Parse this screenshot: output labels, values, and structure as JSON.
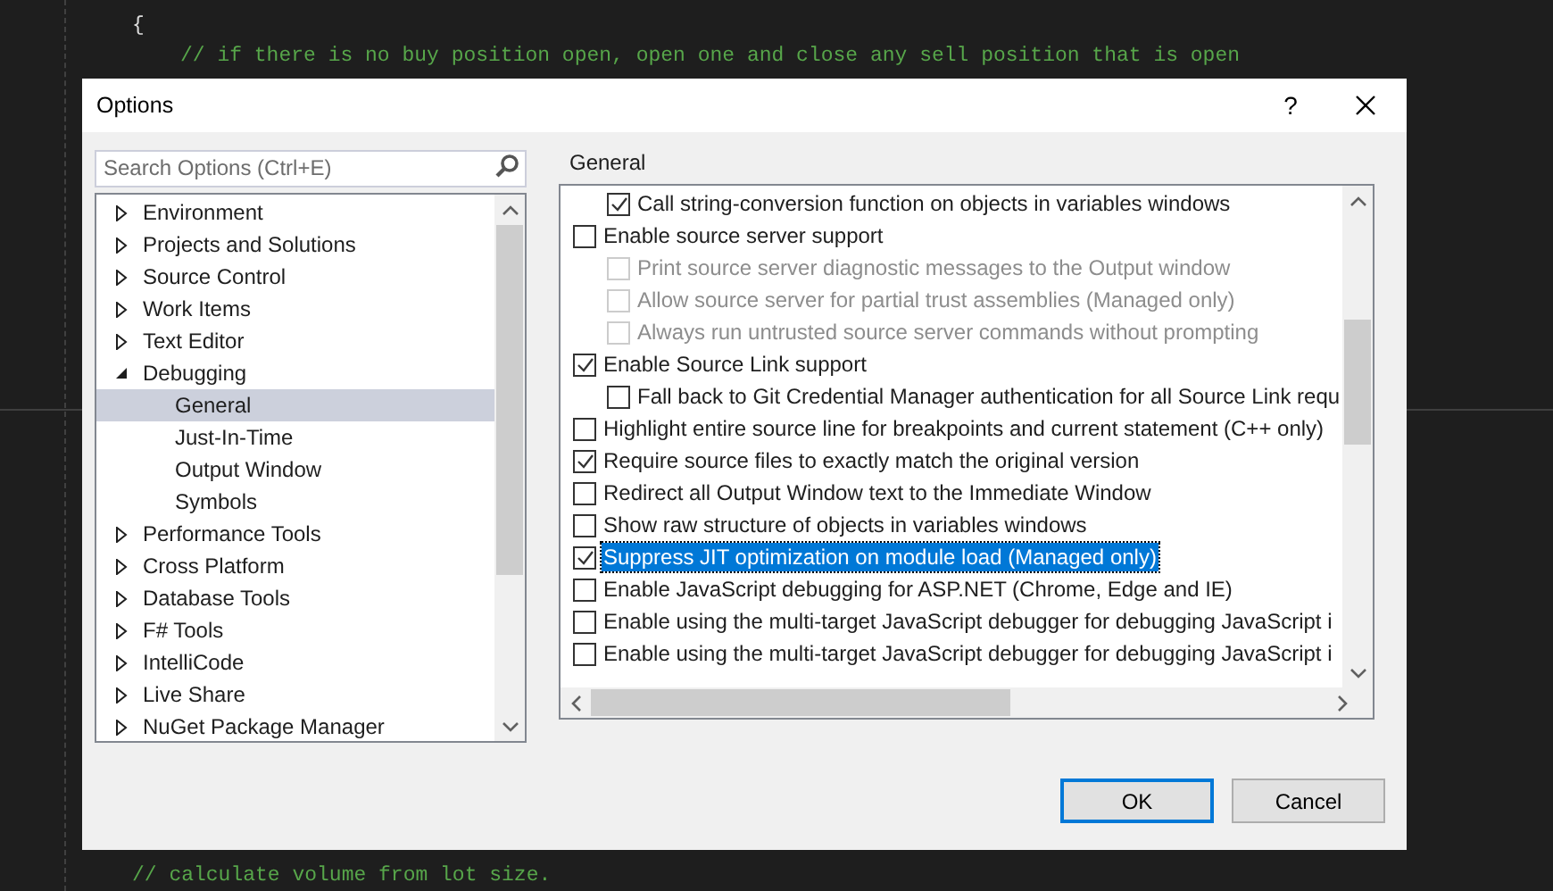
{
  "editor": {
    "lines": [
      {
        "text": "{",
        "kind": "brace"
      },
      {
        "text": "// if there is no buy position open, open one and close any sell position that is open",
        "kind": "inner_comment"
      }
    ],
    "bottom_lines": [
      {
        "text": "// calculate volume from lot size.",
        "kind": "comment"
      }
    ]
  },
  "dialog": {
    "title": "Options",
    "help": "?",
    "search": {
      "placeholder": "Search Options (Ctrl+E)"
    },
    "tree": [
      {
        "label": "Environment",
        "expanded": false,
        "selected": false
      },
      {
        "label": "Projects and Solutions",
        "expanded": false,
        "selected": false
      },
      {
        "label": "Source Control",
        "expanded": false,
        "selected": false
      },
      {
        "label": "Work Items",
        "expanded": false,
        "selected": false
      },
      {
        "label": "Text Editor",
        "expanded": false,
        "selected": false
      },
      {
        "label": "Debugging",
        "expanded": true,
        "selected": false,
        "children": [
          {
            "label": "General",
            "selected": true
          },
          {
            "label": "Just-In-Time",
            "selected": false
          },
          {
            "label": "Output Window",
            "selected": false
          },
          {
            "label": "Symbols",
            "selected": false
          }
        ]
      },
      {
        "label": "Performance Tools",
        "expanded": false,
        "selected": false
      },
      {
        "label": "Cross Platform",
        "expanded": false,
        "selected": false
      },
      {
        "label": "Database Tools",
        "expanded": false,
        "selected": false
      },
      {
        "label": "F# Tools",
        "expanded": false,
        "selected": false
      },
      {
        "label": "IntelliCode",
        "expanded": false,
        "selected": false
      },
      {
        "label": "Live Share",
        "expanded": false,
        "selected": false
      },
      {
        "label": "NuGet Package Manager",
        "expanded": false,
        "selected": false
      }
    ],
    "section": "General",
    "options": [
      {
        "kind": "sub",
        "label": "Call string-conversion function on objects in variables windows",
        "checked": true,
        "disabled": false,
        "selected": false
      },
      {
        "kind": "top",
        "label": "Enable source server support",
        "checked": false,
        "disabled": false,
        "selected": false
      },
      {
        "kind": "sub",
        "label": "Print source server diagnostic messages to the Output window",
        "checked": false,
        "disabled": true,
        "selected": false
      },
      {
        "kind": "sub",
        "label": "Allow source server for partial trust assemblies (Managed only)",
        "checked": false,
        "disabled": true,
        "selected": false
      },
      {
        "kind": "sub",
        "label": "Always run untrusted source server commands without prompting",
        "checked": false,
        "disabled": true,
        "selected": false
      },
      {
        "kind": "top",
        "label": "Enable Source Link support",
        "checked": true,
        "disabled": false,
        "selected": false
      },
      {
        "kind": "sub",
        "label": "Fall back to Git Credential Manager authentication for all Source Link requ",
        "checked": false,
        "disabled": false,
        "selected": false
      },
      {
        "kind": "top",
        "label": "Highlight entire source line for breakpoints and current statement (C++ only)",
        "checked": false,
        "disabled": false,
        "selected": false
      },
      {
        "kind": "top",
        "label": "Require source files to exactly match the original version",
        "checked": true,
        "disabled": false,
        "selected": false
      },
      {
        "kind": "top",
        "label": "Redirect all Output Window text to the Immediate Window",
        "checked": false,
        "disabled": false,
        "selected": false
      },
      {
        "kind": "top",
        "label": "Show raw structure of objects in variables windows",
        "checked": false,
        "disabled": false,
        "selected": false
      },
      {
        "kind": "top",
        "label": "Suppress JIT optimization on module load (Managed only)",
        "checked": true,
        "disabled": false,
        "selected": true
      },
      {
        "kind": "top",
        "label": "Enable JavaScript debugging for ASP.NET (Chrome, Edge and IE)",
        "checked": false,
        "disabled": false,
        "selected": false
      },
      {
        "kind": "top",
        "label": "Enable using the multi-target JavaScript debugger for debugging JavaScript i",
        "checked": false,
        "disabled": false,
        "selected": false
      },
      {
        "kind": "top",
        "label": "Enable using the multi-target JavaScript debugger for debugging JavaScript i",
        "checked": false,
        "disabled": false,
        "selected": false
      }
    ],
    "buttons": [
      {
        "label": "OK",
        "kind": "default"
      },
      {
        "label": "Cancel",
        "kind": "normal"
      }
    ]
  }
}
